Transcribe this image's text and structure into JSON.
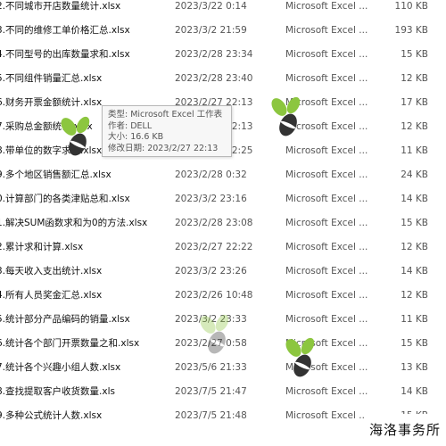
{
  "files": [
    {
      "name": "2.不同城市开店数量统计.xlsx",
      "date": "2023/3/22 0:14",
      "type": "Microsoft Excel ...",
      "size": "110 KB"
    },
    {
      "name": "3.不同的维修工单价格汇总.xlsx",
      "date": "2023/3/2 21:59",
      "type": "Microsoft Excel ...",
      "size": "193 KB"
    },
    {
      "name": "4.不同型号的出库数量求和.xlsx",
      "date": "2023/2/28 23:34",
      "type": "Microsoft Excel ...",
      "size": "15 KB"
    },
    {
      "name": "5.不同组件销量汇总.xlsx",
      "date": "2023/2/28 23:40",
      "type": "Microsoft Excel ...",
      "size": "12 KB"
    },
    {
      "name": "6.财务开票金额统计.xlsx",
      "date": "2023/2/27 22:13",
      "type": "Microsoft Excel ...",
      "size": "17 KB"
    },
    {
      "name": "7.采购总金额统计.xlsx",
      "date": "2023/2/27 22:13",
      "type": "Microsoft Excel ...",
      "size": "12 KB"
    },
    {
      "name": "8.带单位的数字求和.xlsx",
      "date": "2023/2/27 22:25",
      "type": "Microsoft Excel ...",
      "size": "11 KB"
    },
    {
      "name": "9.多个地区销售额汇总.xlsx",
      "date": "2023/2/28 0:32",
      "type": "Microsoft Excel ...",
      "size": "24 KB"
    },
    {
      "name": "0.计算部门的各类津贴总和.xlsx",
      "date": "2023/3/2 23:16",
      "type": "Microsoft Excel ...",
      "size": "14 KB"
    },
    {
      "name": "1.解决SUM函数求和为0的方法.xlsx",
      "date": "2023/2/28 23:08",
      "type": "Microsoft Excel ...",
      "size": "15 KB"
    },
    {
      "name": "2.累计求和计算.xlsx",
      "date": "2023/2/27 22:22",
      "type": "Microsoft Excel ...",
      "size": "12 KB"
    },
    {
      "name": "3.每天收入支出统计.xlsx",
      "date": "2023/3/2 23:26",
      "type": "Microsoft Excel ...",
      "size": "14 KB"
    },
    {
      "name": "4.所有人员奖金汇总.xlsx",
      "date": "2023/2/26 10:48",
      "type": "Microsoft Excel ...",
      "size": "12 KB"
    },
    {
      "name": "5.统计部分产品编码的销量.xlsx",
      "date": "2023/3/2 23:33",
      "type": "Microsoft Excel ...",
      "size": "11 KB"
    },
    {
      "name": "6.统计各个部门开票数量之和.xlsx",
      "date": "2023/2/27 0:58",
      "type": "Microsoft Excel ...",
      "size": "15 KB"
    },
    {
      "name": "7.统计各个兴趣小组人数.xlsx",
      "date": "2023/5/6 21:33",
      "type": "Microsoft Excel ...",
      "size": "13 KB"
    },
    {
      "name": "8.查找提取客户收货数量.xls",
      "date": "2023/7/5 21:47",
      "type": "Microsoft Excel ...",
      "size": "14 KB"
    },
    {
      "name": "9.多种公式统计人数.xlsx",
      "date": "2023/7/5 21:48",
      "type": "Microsoft Excel ...",
      "size": "15 KB"
    }
  ],
  "tooltip": {
    "type_line": "类型: Microsoft Excel 工作表",
    "author_line": "作者: DELL",
    "size_line": "大小: 16.6 KB",
    "modified_line": "修改日期: 2023/2/27 22:13"
  },
  "watermark_label": "海洛事务所",
  "colors": {
    "watermark_green": "#8cc63f",
    "watermark_dark": "#333333"
  }
}
